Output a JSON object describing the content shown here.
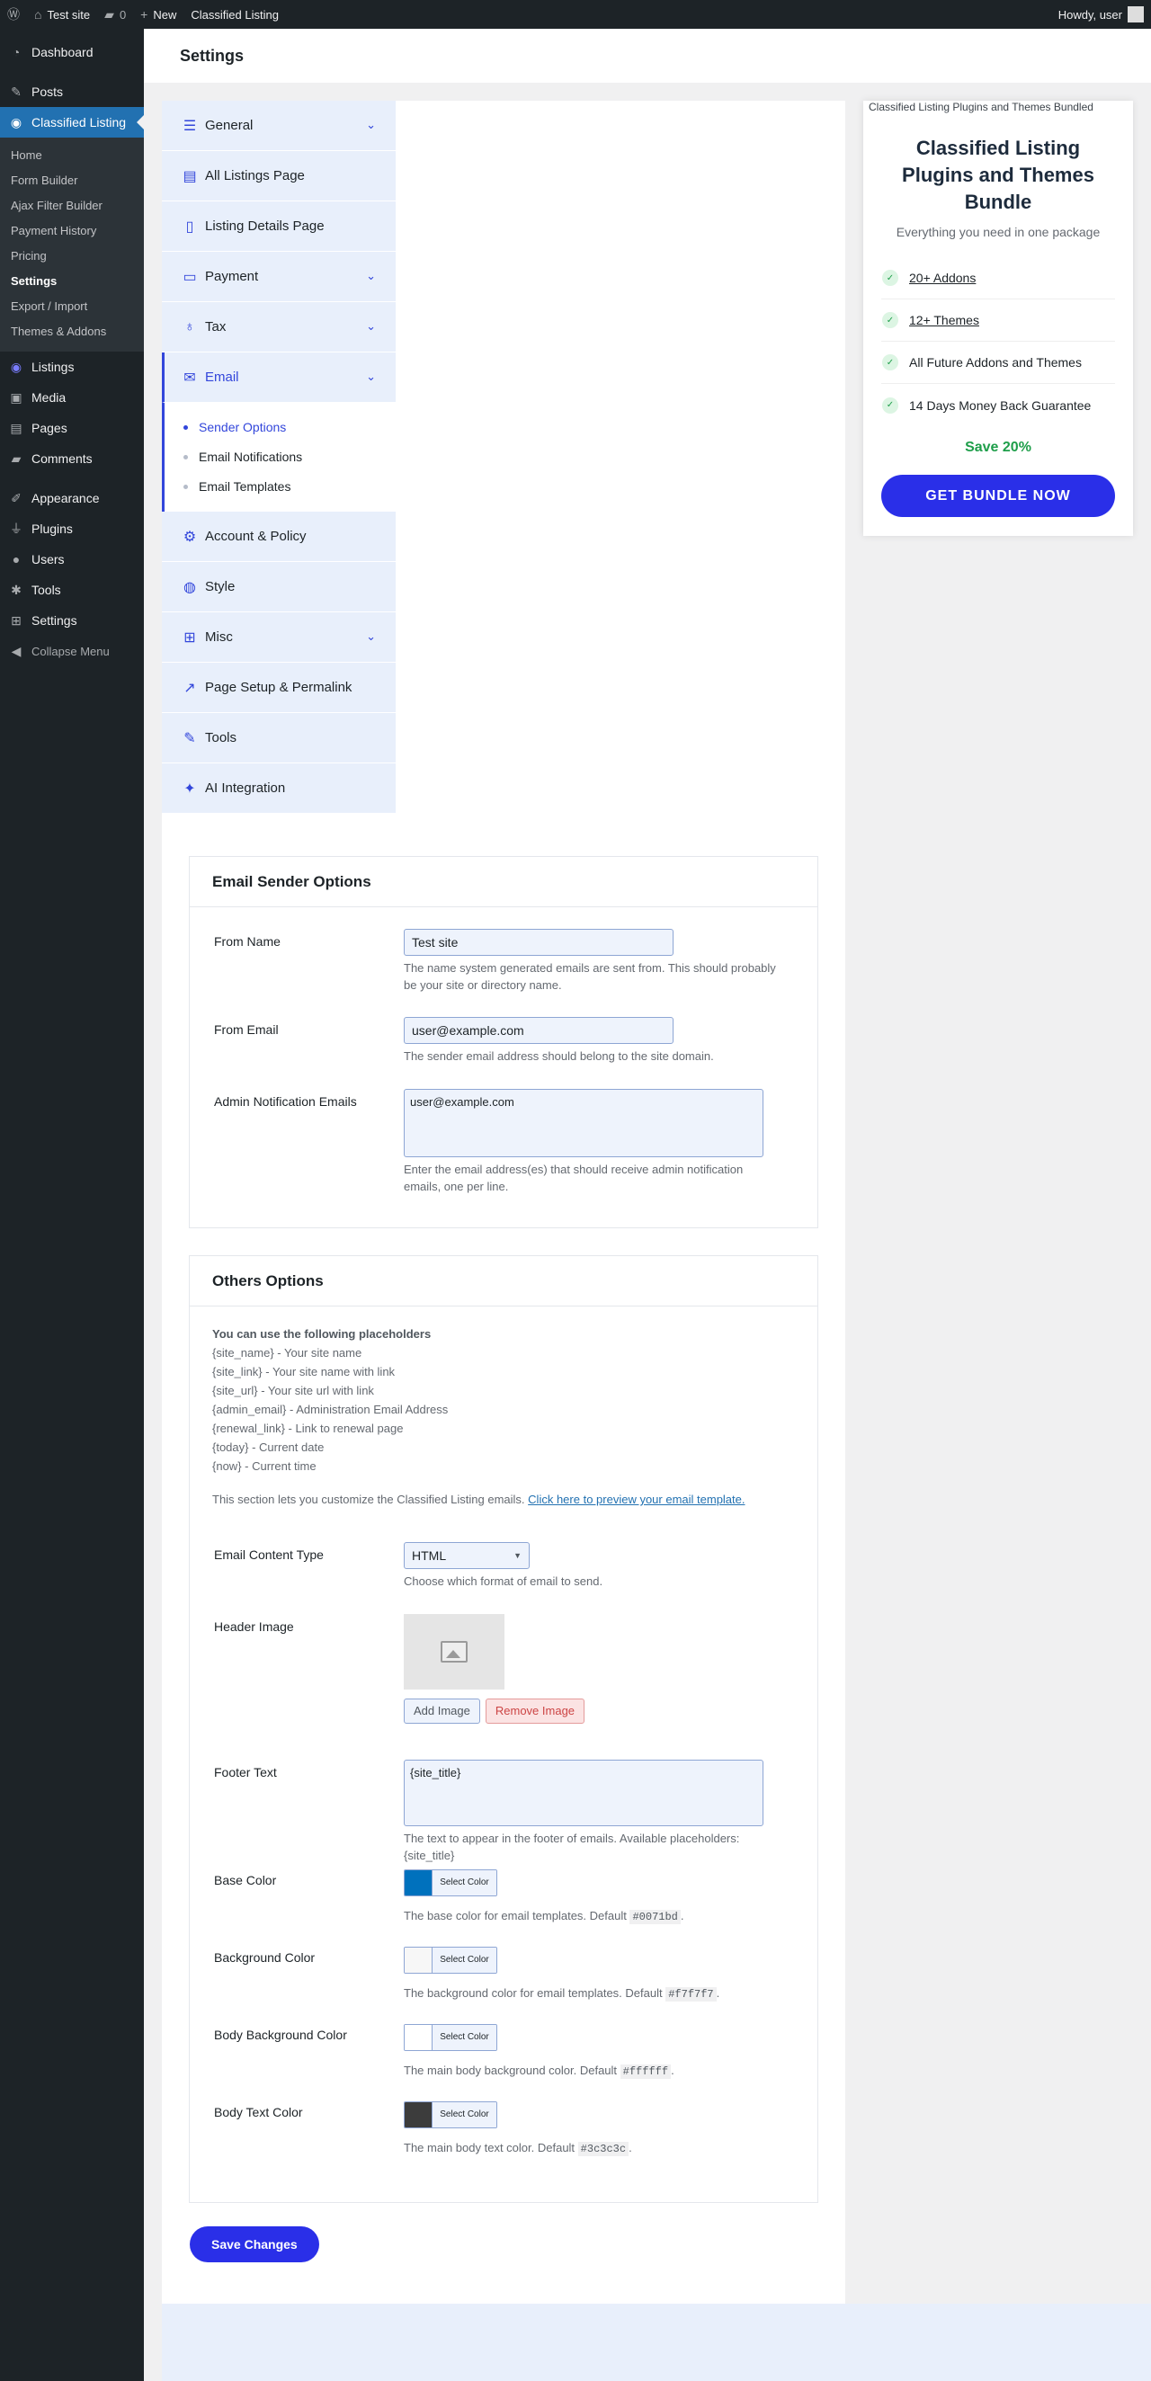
{
  "adminbar": {
    "site": "Test site",
    "comments": "0",
    "new": "New",
    "plugin": "Classified Listing",
    "howdy": "Howdy, user"
  },
  "sidebar": {
    "dashboard": "Dashboard",
    "posts": "Posts",
    "classified": "Classified Listing",
    "submenu": [
      "Home",
      "Form Builder",
      "Ajax Filter Builder",
      "Payment History",
      "Pricing",
      "Settings",
      "Export / Import",
      "Themes & Addons"
    ],
    "rest": [
      "Listings",
      "Media",
      "Pages",
      "Comments"
    ],
    "rest2": [
      "Appearance",
      "Plugins",
      "Users",
      "Tools",
      "Settings"
    ],
    "collapse": "Collapse Menu"
  },
  "page_title": "Settings",
  "tabs": [
    "General",
    "All Listings Page",
    "Listing Details Page",
    "Payment",
    "Tax",
    "Email"
  ],
  "email_subtabs": [
    "Sender Options",
    "Email Notifications",
    "Email Templates"
  ],
  "tabs_after": [
    "Account & Policy",
    "Style",
    "Misc",
    "Page Setup & Permalink",
    "Tools",
    "AI Integration"
  ],
  "sender": {
    "title": "Email Sender Options",
    "from_name_label": "From Name",
    "from_name_value": "Test site",
    "from_name_desc": "The name system generated emails are sent from. This should probably be your site or directory name.",
    "from_email_label": "From Email",
    "from_email_value": "user@example.com",
    "from_email_desc": "The sender email address should belong to the site domain.",
    "admin_label": "Admin Notification Emails",
    "admin_value": "user@example.com",
    "admin_desc": "Enter the email address(es) that should receive admin notification emails, one per line."
  },
  "others": {
    "title": "Others Options",
    "ph_heading": "You can use the following placeholders",
    "placeholders": [
      "{site_name} - Your site name",
      "{site_link} - Your site name with link",
      "{site_url} - Your site url with link",
      "{admin_email} - Administration Email Address",
      "{renewal_link} - Link to renewal page",
      "{today} - Current date",
      "{now} - Current time"
    ],
    "intro": "This section lets you customize the Classified Listing emails.",
    "intro_link": "Click here to preview your email template.",
    "content_type_label": "Email Content Type",
    "content_type_value": "HTML",
    "content_type_desc": "Choose which format of email to send.",
    "header_image_label": "Header Image",
    "add_image": "Add Image",
    "remove_image": "Remove Image",
    "footer_label": "Footer Text",
    "footer_value": "{site_title}",
    "footer_desc": "The text to appear in the footer of emails. Available placeholders: {site_title}",
    "select_color": "Select Color",
    "base_label": "Base Color",
    "base_desc": "The base color for email templates. Default",
    "base_code": "#0071bd",
    "bg_label": "Background Color",
    "bg_desc": "The background color for email templates. Default",
    "bg_code": "#f7f7f7",
    "body_bg_label": "Body Background Color",
    "body_bg_desc": "The main body background color. Default",
    "body_bg_code": "#ffffff",
    "body_text_label": "Body Text Color",
    "body_text_desc": "The main body text color. Default",
    "body_text_code": "#3c3c3c",
    "save": "Save Changes"
  },
  "promo": {
    "img_alt": "Classified Listing Plugins and Themes Bundled",
    "title": "Classified Listing Plugins and Themes Bundle",
    "subtitle": "Everything you need in one package",
    "features": [
      "20+ Addons",
      "12+ Themes",
      "All Future Addons and Themes",
      "14 Days Money Back Guarantee"
    ],
    "save": "Save 20%",
    "cta": "GET BUNDLE NOW"
  },
  "colors": {
    "accent": "#3246db",
    "wp_blue": "#2271b1",
    "swatch_base": "#0071bd",
    "swatch_bg": "#f7f7f7",
    "swatch_body_bg": "#ffffff",
    "swatch_text": "#3c3c3c"
  }
}
